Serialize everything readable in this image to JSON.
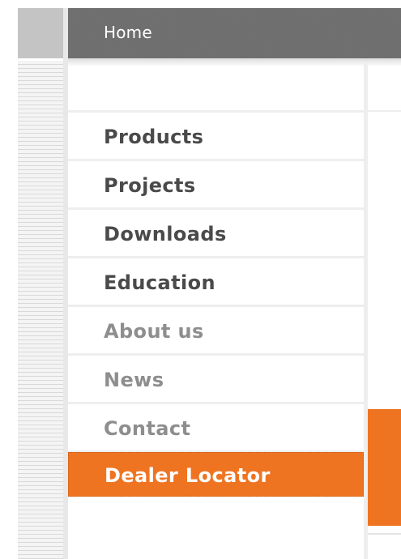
{
  "header": {
    "home_label": "Home"
  },
  "nav": {
    "items": [
      {
        "label": "Products",
        "state": "default"
      },
      {
        "label": "Projects",
        "state": "default"
      },
      {
        "label": "Downloads",
        "state": "default"
      },
      {
        "label": "Education",
        "state": "default"
      },
      {
        "label": "About us",
        "state": "muted"
      },
      {
        "label": "News",
        "state": "muted"
      },
      {
        "label": "Contact",
        "state": "muted"
      },
      {
        "label": "Dealer Locator",
        "state": "active"
      }
    ]
  },
  "colors": {
    "accent": "#ef7421",
    "header_bg": "#6f6f6f",
    "nav_text_dark": "#4a4a4a",
    "nav_text_muted": "#8e8e8e"
  }
}
